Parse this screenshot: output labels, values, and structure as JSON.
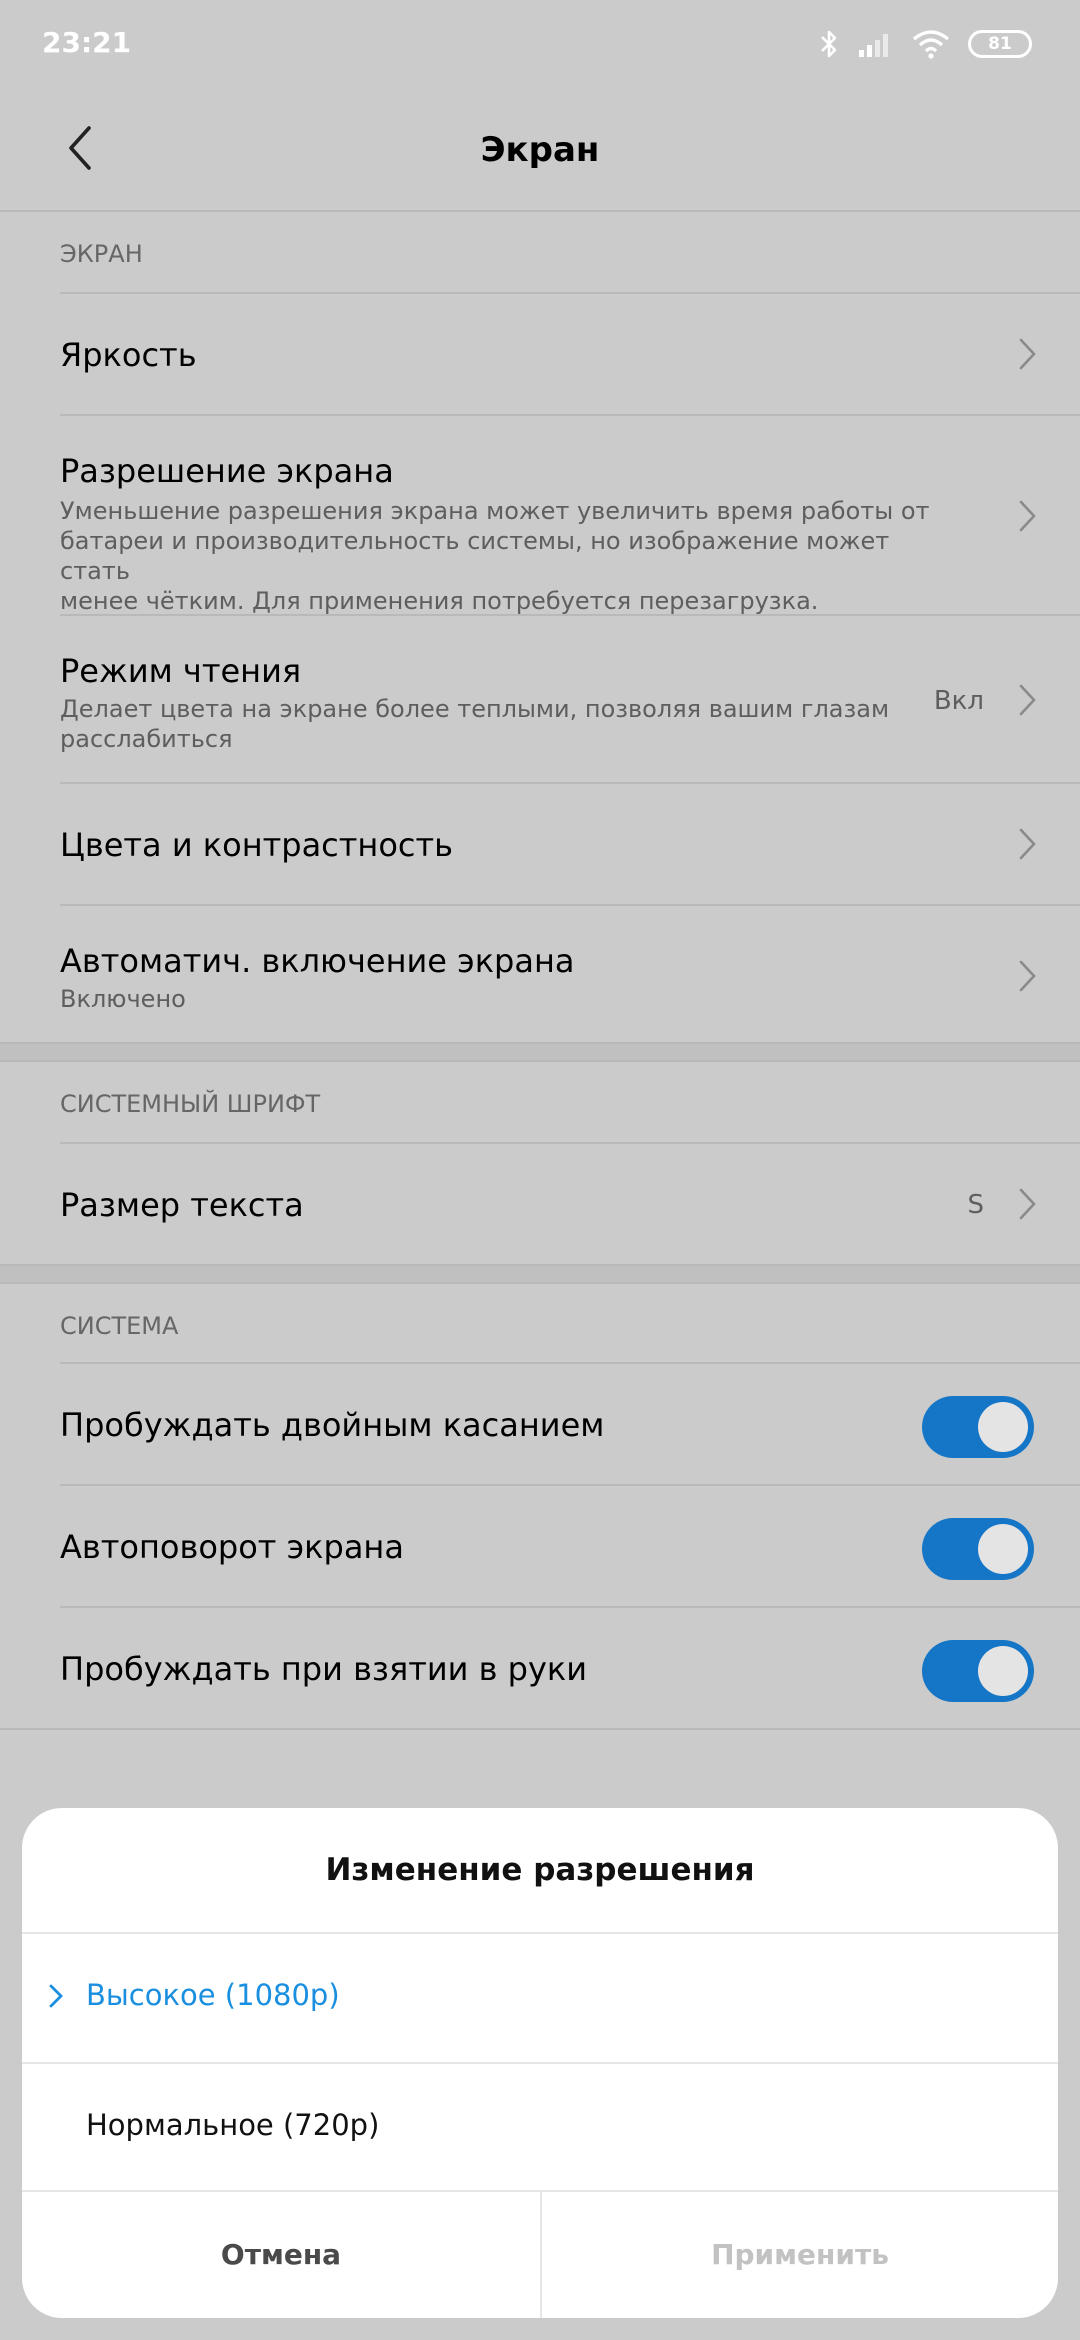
{
  "status_bar": {
    "time": "23:21",
    "battery": "81"
  },
  "header": {
    "title": "Экран"
  },
  "sections": {
    "screen": {
      "header": "ЭКРАН",
      "brightness": {
        "title": "Яркость"
      },
      "resolution": {
        "title": "Разрешение экрана",
        "subtitle_lines": [
          "Уменьшение разрешения экрана может увеличить время работы от",
          "батареи и производительность системы, но изображение может стать",
          "менее чётким. Для применения потребуется перезагрузка."
        ]
      },
      "reading_mode": {
        "title": "Режим чтения",
        "subtitle_lines": [
          "Делает цвета на экране более теплыми, позволяя вашим глазам",
          "расслабиться"
        ],
        "value": "Вкл"
      },
      "colors": {
        "title": "Цвета и контрастность"
      },
      "auto_wake": {
        "title": "Автоматич. включение экрана",
        "subtitle": "Включено"
      }
    },
    "font": {
      "header": "СИСТЕМНЫЙ ШРИФТ",
      "text_size": {
        "title": "Размер текста",
        "value": "S"
      }
    },
    "system": {
      "header": "СИСТЕМА",
      "double_tap": {
        "title": "Пробуждать двойным касанием",
        "on": true
      },
      "auto_rotate": {
        "title": "Автоповорот экрана",
        "on": true
      },
      "lift_to_wake": {
        "title": "Пробуждать при взятии в руки",
        "on": true
      }
    }
  },
  "dialog": {
    "title": "Изменение разрешения",
    "options": [
      {
        "label": "Высокое (1080p)",
        "selected": true
      },
      {
        "label": "Нормальное (720p)",
        "selected": false
      }
    ],
    "cancel_label": "Отмена",
    "apply_label": "Применить"
  },
  "colors": {
    "toggle_on": "#1575c6",
    "selected_option": "#1a8fe0",
    "scrim_background": "#cbcbcb"
  }
}
